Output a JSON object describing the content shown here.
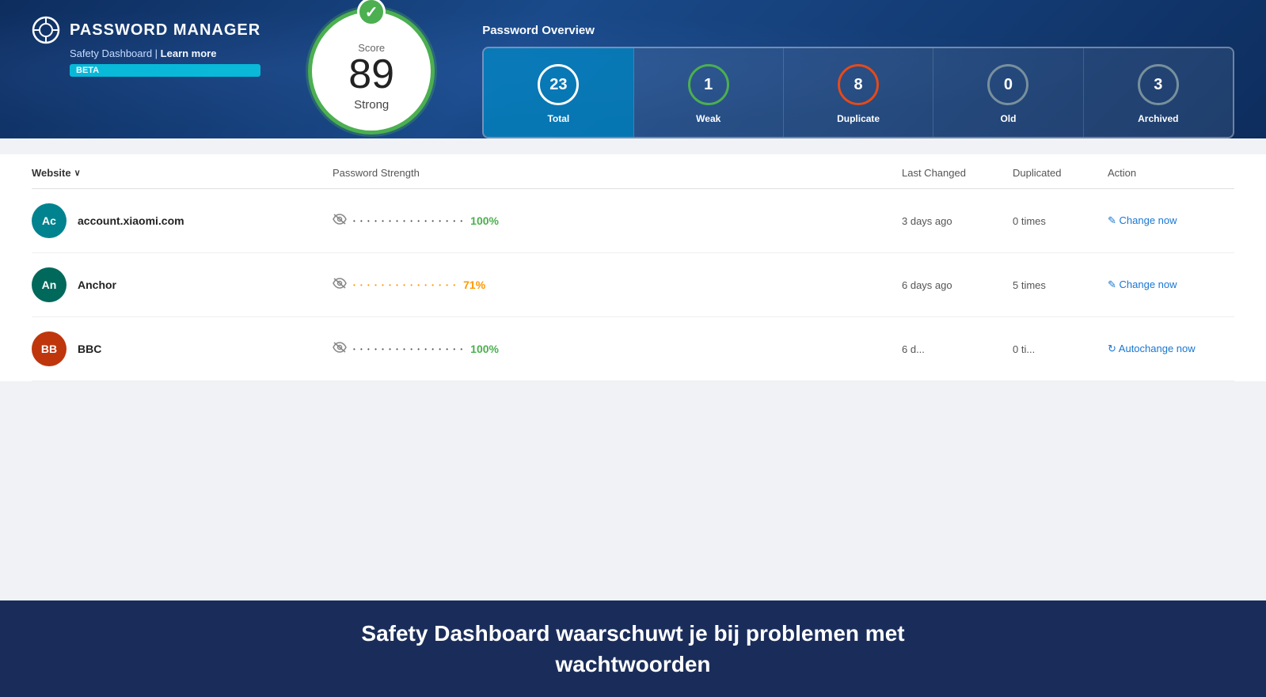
{
  "brand": {
    "title": "PASSWORD MANAGER",
    "subtitle_text": "Safety Dashboard | ",
    "subtitle_link": "Learn more",
    "beta": "BETA"
  },
  "score": {
    "label": "Score",
    "value": "89",
    "strength": "Strong"
  },
  "overview": {
    "title": "Password Overview",
    "cards": [
      {
        "id": "total",
        "count": "23",
        "label": "Total",
        "active": true,
        "circle_class": "total"
      },
      {
        "id": "weak",
        "count": "1",
        "label": "Weak",
        "active": false,
        "circle_class": "weak"
      },
      {
        "id": "duplicate",
        "count": "8",
        "label": "Duplicate",
        "active": false,
        "circle_class": "duplicate"
      },
      {
        "id": "old",
        "count": "0",
        "label": "Old",
        "active": false,
        "circle_class": "old"
      },
      {
        "id": "archived",
        "count": "3",
        "label": "Archived",
        "active": false,
        "circle_class": "archived"
      }
    ]
  },
  "table": {
    "headers": {
      "website": "Website",
      "password_strength": "Password Strength",
      "last_changed": "Last Changed",
      "duplicated": "Duplicated",
      "action": "Action"
    },
    "rows": [
      {
        "avatar_text": "Ac",
        "avatar_color": "#00838f",
        "site_name": "account.xiaomi.com",
        "dots_class": "green",
        "strength_pct": "100%",
        "strength_color": "green",
        "last_changed": "3 days ago",
        "duplicated": "0 times",
        "action_label": "Change now",
        "action_type": "change"
      },
      {
        "avatar_text": "An",
        "avatar_color": "#00695c",
        "site_name": "Anchor",
        "dots_class": "orange",
        "strength_pct": "71%",
        "strength_color": "orange",
        "last_changed": "6 days ago",
        "duplicated": "5 times",
        "action_label": "Change now",
        "action_type": "change"
      },
      {
        "avatar_text": "BB",
        "avatar_color": "#bf360c",
        "site_name": "BBC",
        "dots_class": "green",
        "strength_pct": "100%",
        "strength_color": "green",
        "last_changed": "6 d...",
        "duplicated": "0 ti...",
        "action_label": "Autochange now",
        "action_type": "autochange"
      }
    ]
  },
  "footer": {
    "line1": "Safety Dashboard waarschuwt je bij problemen met",
    "line2": "wachtwoorden"
  },
  "icons": {
    "checkmark": "✓",
    "chevron_down": "∨",
    "eye_off": "👁",
    "change_icon": "✎",
    "refresh_icon": "↻"
  }
}
